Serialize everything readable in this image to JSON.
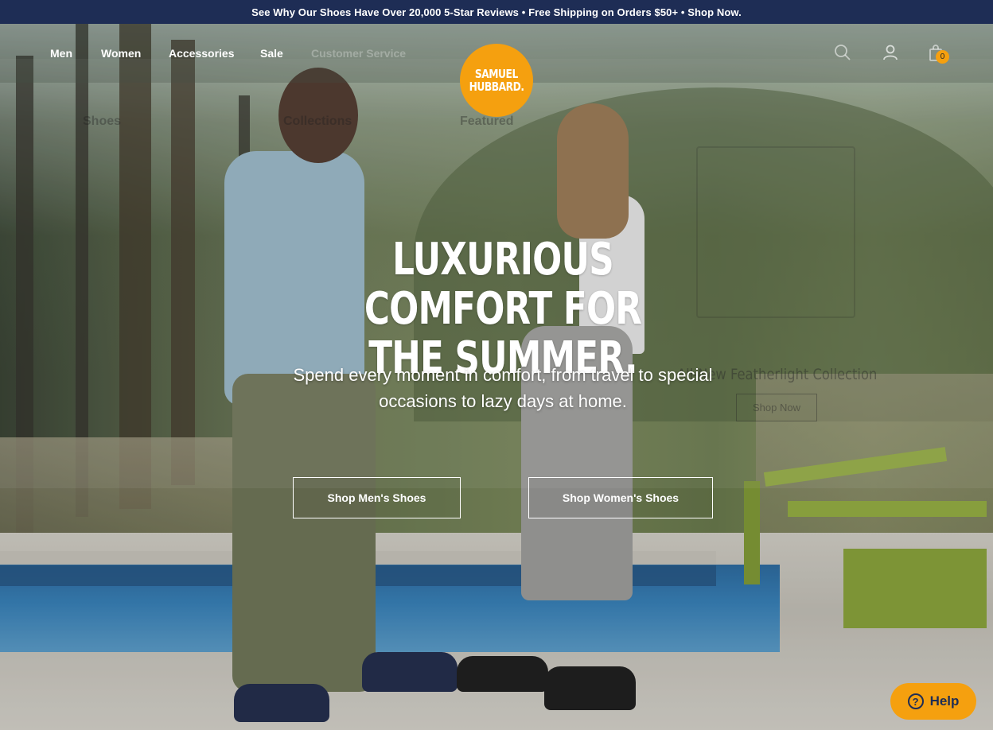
{
  "announcement": "See Why Our Shoes Have Over 20,000 5-Star Reviews • Free Shipping on Orders $50+ • Shop Now.",
  "nav": {
    "items": [
      {
        "label": "Men"
      },
      {
        "label": "Women"
      },
      {
        "label": "Accessories"
      },
      {
        "label": "Sale"
      },
      {
        "label": "Customer Service"
      }
    ]
  },
  "logo": {
    "line1": "SAMUEL",
    "line2": "HUBBARD."
  },
  "header_icons": {
    "search": "search-icon",
    "account": "user-icon",
    "cart": "bag-icon",
    "cart_count": "0"
  },
  "mega_menu_ghost": {
    "col1": "Shoes",
    "col2": "Collections",
    "col3": "Featured",
    "promo_title": "All-New Featherlight Collection",
    "promo_button": "Shop Now"
  },
  "hero": {
    "headline_line1": "LUXURIOUS COMFORT FOR",
    "headline_line2": "THE SUMMER.",
    "subhead_line1": "Spend every moment in comfort, from travel to special",
    "subhead_line2": "occasions to lazy days at home.",
    "cta_men": "Shop Men's Shoes",
    "cta_women": "Shop Women's Shoes"
  },
  "help": {
    "label": "Help"
  },
  "colors": {
    "announce_bg": "#1e2d55",
    "brand_orange": "#f5a00f"
  }
}
